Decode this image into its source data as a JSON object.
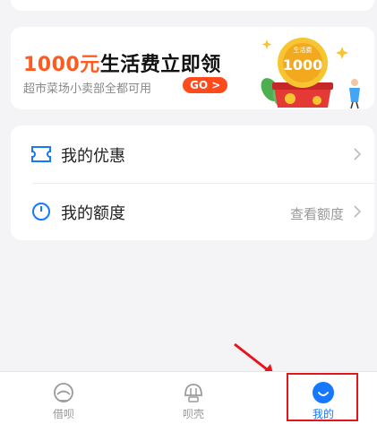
{
  "promo": {
    "amount": "1000元",
    "title_rest": "生活费立即领",
    "subtitle": "超市菜场小卖部全都可用",
    "go_label": "GO >",
    "badge_top": "生活费",
    "badge_value": "1000"
  },
  "menu": {
    "items": [
      {
        "label": "我的优惠",
        "right_text": "",
        "icon": "coupon-icon"
      },
      {
        "label": "我的额度",
        "right_text": "查看额度",
        "icon": "clock-icon"
      }
    ]
  },
  "tabbar": {
    "tabs": [
      {
        "label": "借呗",
        "icon": "jiebei-icon",
        "active": false
      },
      {
        "label": "呗壳",
        "icon": "beike-icon",
        "active": false
      },
      {
        "label": "我的",
        "icon": "profile-smile-icon",
        "active": true
      }
    ]
  },
  "colors": {
    "accent": "#1677ff",
    "promo_orange": "#ff5a1f",
    "highlight_red": "#e8141b",
    "background": "#f4f4f6"
  }
}
